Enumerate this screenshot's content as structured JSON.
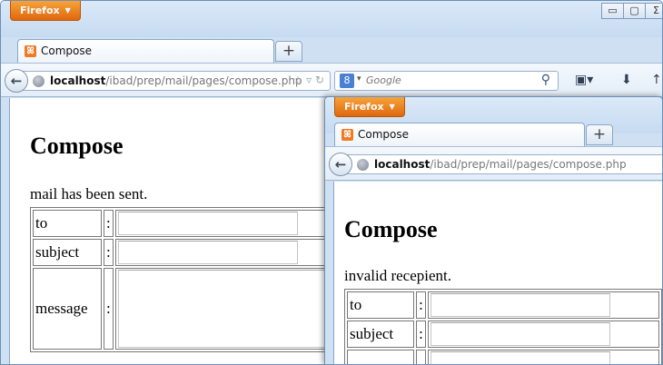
{
  "back_window": {
    "menu_button": "Firefox",
    "tab_title": "Compose",
    "new_tab": "+",
    "url_host": "localhost",
    "url_path": "/ibad/prep/mail/pages/compose.php",
    "search_placeholder": "Google",
    "controls": {
      "minimize": "▭",
      "maximize": "▢",
      "close": "Σ"
    },
    "page": {
      "heading": "Compose",
      "status": "mail has been sent.",
      "fields": [
        {
          "label": "to",
          "colon": ":"
        },
        {
          "label": "subject",
          "colon": ":"
        },
        {
          "label": "message",
          "colon": ":"
        }
      ]
    }
  },
  "front_window": {
    "menu_button": "Firefox",
    "tab_title": "Compose",
    "new_tab": "+",
    "url_host": "localhost",
    "url_path": "/ibad/prep/mail/pages/compose.php",
    "page": {
      "heading": "Compose",
      "status": "invalid recepient.",
      "fields": [
        {
          "label": "to",
          "colon": ":"
        },
        {
          "label": "subject",
          "colon": ":"
        }
      ]
    }
  },
  "colors": {
    "firefox_orange": "#e8781b",
    "chrome_blue": "#cfe0f3"
  }
}
